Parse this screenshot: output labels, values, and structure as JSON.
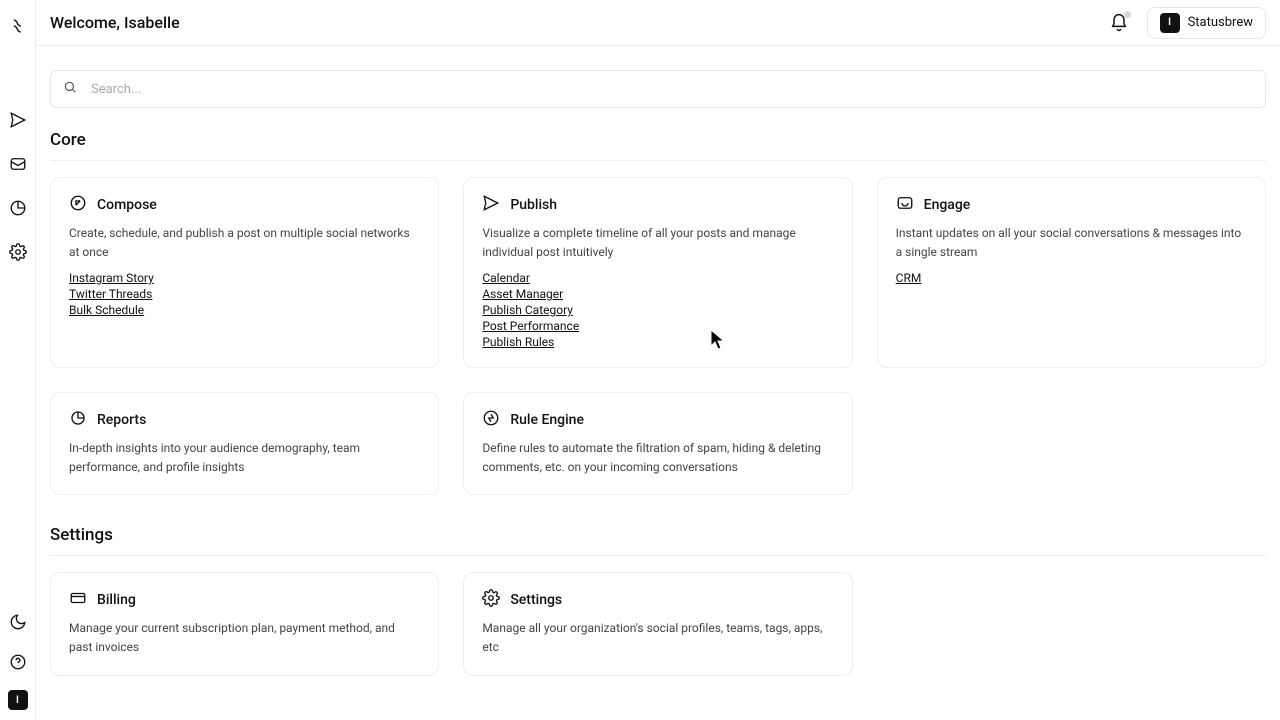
{
  "header": {
    "title": "Welcome, Isabelle",
    "brand_label": "Statusbrew",
    "brand_initial": "I"
  },
  "search": {
    "placeholder": "Search..."
  },
  "sections": {
    "core": {
      "title": "Core",
      "cards": {
        "compose": {
          "title": "Compose",
          "desc": "Create, schedule, and publish a post on multiple social networks at once",
          "links": [
            "Instagram Story",
            "Twitter Threads",
            "Bulk Schedule"
          ]
        },
        "publish": {
          "title": "Publish",
          "desc": "Visualize a complete timeline of all your posts and manage individual post intuitively",
          "links": [
            "Calendar",
            "Asset Manager",
            "Publish Category",
            "Post Performance",
            "Publish Rules"
          ]
        },
        "engage": {
          "title": "Engage",
          "desc": "Instant updates on all your social conversations & messages into a single stream",
          "links": [
            "CRM"
          ]
        },
        "reports": {
          "title": "Reports",
          "desc": "In-depth insights into your audience demography, team performance, and profile insights"
        },
        "rule_engine": {
          "title": "Rule Engine",
          "desc": "Define rules to automate the filtration of spam, hiding & deleting comments, etc. on your incoming conversations"
        }
      }
    },
    "settings": {
      "title": "Settings",
      "cards": {
        "billing": {
          "title": "Billing",
          "desc": "Manage your current subscription plan, payment method, and past invoices"
        },
        "settings": {
          "title": "Settings",
          "desc": "Manage all your organization's social profiles, teams, tags, apps, etc"
        }
      }
    }
  },
  "sidebar": {
    "avatar_initial": "I"
  }
}
